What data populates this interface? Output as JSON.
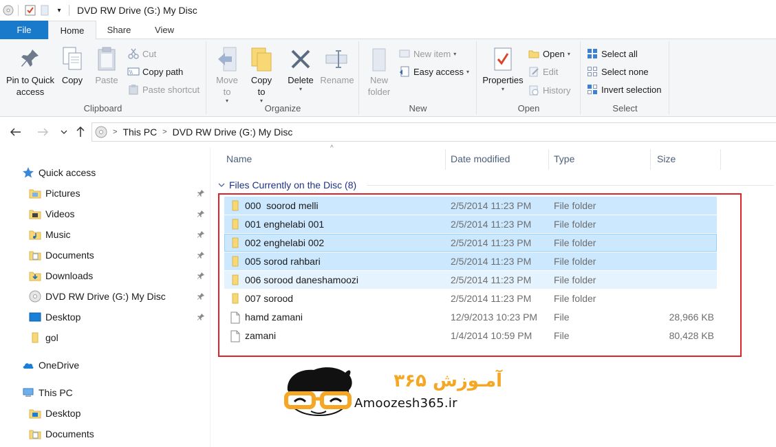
{
  "window": {
    "title": "DVD RW Drive (G:) My Disc"
  },
  "tabs": [
    {
      "label": "File"
    },
    {
      "label": "Home"
    },
    {
      "label": "Share"
    },
    {
      "label": "View"
    }
  ],
  "ribbon": {
    "clipboard": {
      "label": "Clipboard",
      "pin": "Pin to Quick",
      "pin2": "access",
      "copy": "Copy",
      "paste": "Paste",
      "cut": "Cut",
      "copy_path": "Copy path",
      "paste_shortcut": "Paste shortcut"
    },
    "organize": {
      "label": "Organize",
      "move": "Move",
      "move2": "to",
      "copy": "Copy",
      "copy2": "to",
      "delete": "Delete",
      "rename": "Rename"
    },
    "new": {
      "label": "New",
      "new_folder": "New",
      "new_folder2": "folder",
      "new_item": "New item",
      "easy_access": "Easy access"
    },
    "open": {
      "label": "Open",
      "properties": "Properties",
      "open": "Open",
      "edit": "Edit",
      "history": "History"
    },
    "select": {
      "label": "Select",
      "select_all": "Select all",
      "select_none": "Select none",
      "invert": "Invert selection"
    }
  },
  "address": {
    "crumbs": [
      "This PC",
      "DVD RW Drive (G:) My Disc"
    ]
  },
  "navpane": {
    "quick_access": "Quick access",
    "items": [
      {
        "label": "Pictures"
      },
      {
        "label": "Videos"
      },
      {
        "label": "Music"
      },
      {
        "label": "Documents"
      },
      {
        "label": "Downloads"
      },
      {
        "label": "DVD RW Drive (G:) My Disc"
      },
      {
        "label": "Desktop"
      },
      {
        "label": "gol"
      }
    ],
    "onedrive": "OneDrive",
    "this_pc": "This PC",
    "pc_items": [
      {
        "label": "Desktop"
      },
      {
        "label": "Documents"
      }
    ]
  },
  "columns": {
    "name": "Name",
    "date": "Date modified",
    "type": "Type",
    "size": "Size"
  },
  "group_header": "Files Currently on the Disc (8)",
  "files": [
    {
      "name": "000  soorod melli",
      "date": "2/5/2014 11:23 PM",
      "type": "File folder",
      "size": ""
    },
    {
      "name": "001 enghelabi 001",
      "date": "2/5/2014 11:23 PM",
      "type": "File folder",
      "size": ""
    },
    {
      "name": "002 enghelabi 002",
      "date": "2/5/2014 11:23 PM",
      "type": "File folder",
      "size": ""
    },
    {
      "name": "005 sorod rahbari",
      "date": "2/5/2014 11:23 PM",
      "type": "File folder",
      "size": ""
    },
    {
      "name": "006 sorood daneshamoozi",
      "date": "2/5/2014 11:23 PM",
      "type": "File folder",
      "size": ""
    },
    {
      "name": "007 sorood",
      "date": "2/5/2014 11:23 PM",
      "type": "File folder",
      "size": ""
    },
    {
      "name": "hamd zamani",
      "date": "12/9/2013 10:23 PM",
      "type": "File",
      "size": "28,966 KB"
    },
    {
      "name": "zamani",
      "date": "1/4/2014 10:59 PM",
      "type": "File",
      "size": "80,428 KB"
    }
  ],
  "watermark": {
    "text": "Amoozesh365.ir",
    "persian": "آمـوزش ۳۶۵"
  },
  "colors": {
    "accent": "#1979ca",
    "selection": "#cce8ff",
    "highlight_box": "#e0212b",
    "folder": "#f8d775",
    "logo_orange": "#f5a623"
  }
}
